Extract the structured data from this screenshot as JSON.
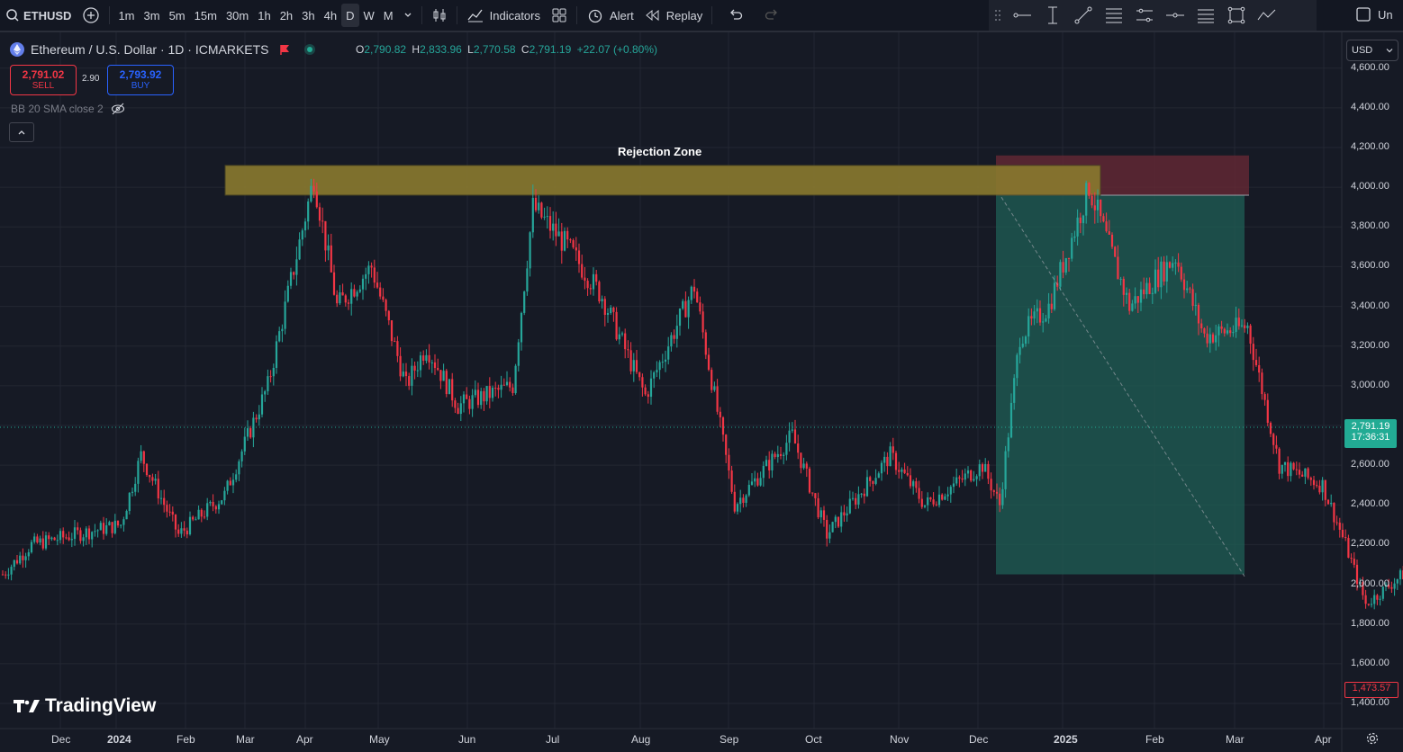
{
  "toolbar": {
    "symbol": "ETHUSD",
    "timeframes": [
      "1m",
      "3m",
      "5m",
      "15m",
      "30m",
      "1h",
      "2h",
      "3h",
      "4h",
      "D",
      "W",
      "M"
    ],
    "active_timeframe": "D",
    "indicators_label": "Indicators",
    "alert_label": "Alert",
    "replay_label": "Replay",
    "right_text": "Un"
  },
  "legend": {
    "title": "Ethereum / U.S. Dollar · 1D · ICMARKETS",
    "open_key": "O",
    "open": "2,790.82",
    "high_key": "H",
    "high": "2,833.96",
    "low_key": "L",
    "low": "2,770.58",
    "close_key": "C",
    "close": "2,791.19",
    "change": "+22.07 (+0.80%)"
  },
  "trade": {
    "sell_price": "2,791.02",
    "sell_label": "SELL",
    "spread": "2.90",
    "buy_price": "2,793.92",
    "buy_label": "BUY"
  },
  "indicator": {
    "label": "BB 20 SMA close 2"
  },
  "currency": "USD",
  "price_axis": [
    "4,600.00",
    "4,400.00",
    "4,200.00",
    "4,000.00",
    "3,800.00",
    "3,600.00",
    "3,400.00",
    "3,200.00",
    "3,000.00",
    "2,600.00",
    "2,400.00",
    "2,200.00",
    "2,000.00",
    "1,800.00",
    "1,600.00",
    "1,400.00"
  ],
  "time_axis": [
    "Dec",
    "2024",
    "Feb",
    "Mar",
    "Apr",
    "May",
    "Jun",
    "Jul",
    "Aug",
    "Sep",
    "Oct",
    "Nov",
    "Dec",
    "2025",
    "Feb",
    "Mar",
    "Apr"
  ],
  "current_price": {
    "price": "2,791.19",
    "countdown": "17:36:31"
  },
  "last_price": "1,473.57",
  "annotation": {
    "rejection_zone": "Rejection Zone"
  },
  "branding": "TradingView",
  "colors": {
    "up": "#26a69a",
    "down": "#f23645",
    "zone": "#8a7a2e",
    "profit": "#1f5f56",
    "loss": "#6b2a35"
  },
  "chart_data": {
    "type": "candlestick",
    "ylim": [
      1400,
      4600
    ],
    "key_levels": {
      "rejection_low": 3960,
      "rejection_high": 4110,
      "target": 2050,
      "stop": 4160
    },
    "path": [
      {
        "t": "2023-11-25",
        "p": 2050
      },
      {
        "t": "2023-12-05",
        "p": 2200
      },
      {
        "t": "2023-12-20",
        "p": 2250
      },
      {
        "t": "2024-01-05",
        "p": 2300
      },
      {
        "t": "2024-01-12",
        "p": 2650
      },
      {
        "t": "2024-01-25",
        "p": 2250
      },
      {
        "t": "2024-02-10",
        "p": 2450
      },
      {
        "t": "2024-02-25",
        "p": 3000
      },
      {
        "t": "2024-03-12",
        "p": 4050
      },
      {
        "t": "2024-03-20",
        "p": 3400
      },
      {
        "t": "2024-04-01",
        "p": 3600
      },
      {
        "t": "2024-04-13",
        "p": 3000
      },
      {
        "t": "2024-04-20",
        "p": 3200
      },
      {
        "t": "2024-05-01",
        "p": 2900
      },
      {
        "t": "2024-05-20",
        "p": 3000
      },
      {
        "t": "2024-05-27",
        "p": 3900
      },
      {
        "t": "2024-06-08",
        "p": 3700
      },
      {
        "t": "2024-06-20",
        "p": 3450
      },
      {
        "t": "2024-07-05",
        "p": 2950
      },
      {
        "t": "2024-07-22",
        "p": 3500
      },
      {
        "t": "2024-08-05",
        "p": 2400
      },
      {
        "t": "2024-08-25",
        "p": 2750
      },
      {
        "t": "2024-09-06",
        "p": 2250
      },
      {
        "t": "2024-09-28",
        "p": 2650
      },
      {
        "t": "2024-10-10",
        "p": 2400
      },
      {
        "t": "2024-10-30",
        "p": 2600
      },
      {
        "t": "2024-11-05",
        "p": 2400
      },
      {
        "t": "2024-11-12",
        "p": 3250
      },
      {
        "t": "2024-11-22",
        "p": 3400
      },
      {
        "t": "2024-12-06",
        "p": 4000
      },
      {
        "t": "2024-12-20",
        "p": 3400
      },
      {
        "t": "2025-01-05",
        "p": 3650
      },
      {
        "t": "2025-01-15",
        "p": 3250
      },
      {
        "t": "2025-01-30",
        "p": 3300
      },
      {
        "t": "2025-02-10",
        "p": 2600
      },
      {
        "t": "2025-02-25",
        "p": 2500
      },
      {
        "t": "2025-03-05",
        "p": 2200
      },
      {
        "t": "2025-03-12",
        "p": 1900
      },
      {
        "t": "2025-03-25",
        "p": 2050
      },
      {
        "t": "2025-04-05",
        "p": 1800
      },
      {
        "t": "2025-04-09",
        "p": 1473.57
      }
    ]
  }
}
